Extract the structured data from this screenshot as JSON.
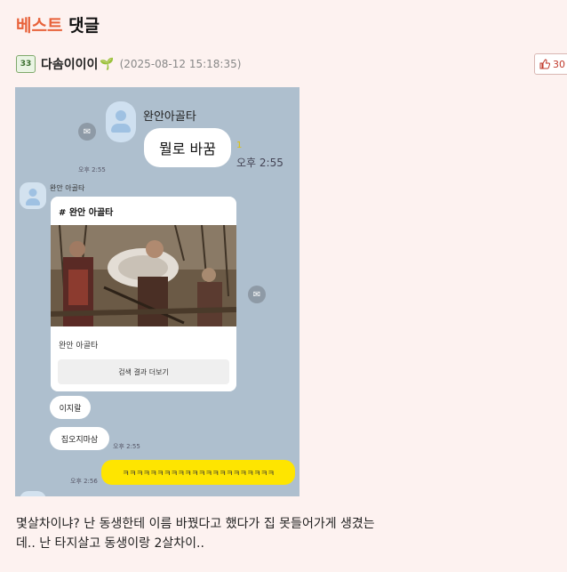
{
  "section": {
    "best_label": "베스트",
    "comment_label": "댓글"
  },
  "comment": {
    "level_badge": "33",
    "author": "다솜이이이",
    "timestamp": "(2025-08-12 15:18:35)",
    "like_count": "30",
    "body_lines": [
      "몇살차이냐? 난 동생한테 이름 바꿨다고 했다가 집 못들어가게 생겼는",
      "데.. 난 타지살고 동생이랑 2살차이.."
    ]
  },
  "screenshot": {
    "top_sender": "완안아골타",
    "top_message": "뭘로 바꿈",
    "unread_count": "1",
    "top_time": "오후 2:55",
    "left_time_1": "오후 2:55",
    "card_sender": "완안 아골타",
    "card_title": "# 완안 아골타",
    "card_name": "완안 아골타",
    "card_button": "검색 결과 더보기",
    "reply_1": "이지랄",
    "reply_2": "집오지마삼",
    "reply_time": "오후 2:55",
    "my_message": "ㅋㅋㅋㅋㅋㅋㅋㅋㅋㅋㅋㅋㅋㅋㅋㅋㅋㅋㅋㅋㅋㅋ",
    "my_time": "오후 2:56"
  },
  "icons": {
    "like": "thumbs-up-icon",
    "share": "share-icon",
    "sprout": "sprout-icon"
  },
  "colors": {
    "best_accent": "#e8623a",
    "chat_bg": "#aebfce",
    "my_bubble": "#fee500",
    "like": "#c0392b"
  }
}
